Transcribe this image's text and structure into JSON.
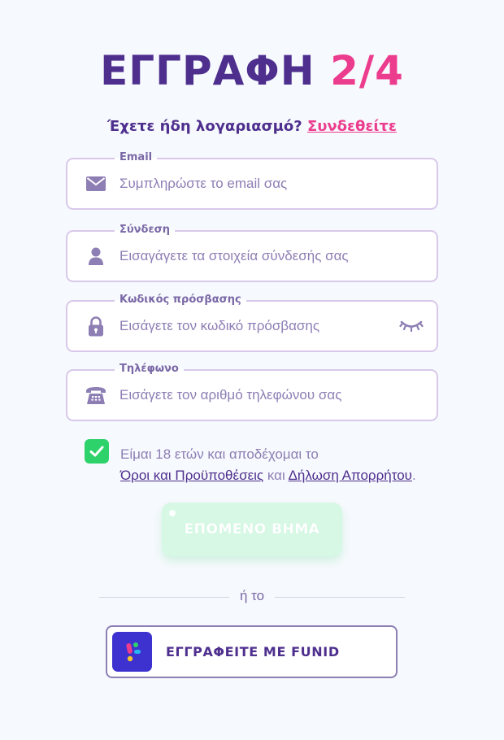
{
  "header": {
    "title": "ΕΓΓΡΑΦΗ",
    "step": "2/4",
    "login_prompt": "Έχετε ήδη λογαριασμό?",
    "login_link": "Συνδεθείτε"
  },
  "form": {
    "fields": [
      {
        "label": "Email",
        "placeholder": "Συμπληρώστε το email σας",
        "value": "",
        "icon": "envelope-icon"
      },
      {
        "label": "Σύνδεση",
        "placeholder": "Εισαγάγετε τα στοιχεία σύνδεσής σας",
        "value": "",
        "icon": "user-icon"
      },
      {
        "label": "Κωδικός πρόσβασης",
        "placeholder": "Εισάγετε τον κωδικό πρόσβασης",
        "value": "",
        "icon": "lock-icon"
      },
      {
        "label": "Τηλέφωνο",
        "placeholder": "Εισάγετε τον αριθμό τηλεφώνου σας",
        "value": "",
        "icon": "telephone-icon"
      }
    ],
    "terms": {
      "checked": true,
      "text_1": "Είμαι 18 ετών και αποδέχομαι το",
      "terms_link": "Όροι και Προϋποθέσεις",
      "and": "και",
      "privacy_link": "Δήλωση Απορρήτου",
      "end": "."
    },
    "next_button": "ΕΠΟΜΕΝΟ ΒΗΜΑ"
  },
  "alt": {
    "or_label": "ή το",
    "funid_button": "ΕΓΓΡΑΦΕΙΤΕ ΜΕ FUNID"
  },
  "colors": {
    "primary": "#4e2f8e",
    "accent": "#ec3c8d",
    "border": "#d8c9ea",
    "icon": "#8d7eb4",
    "success": "#2dd26b",
    "funid_brand": "#3d32cf"
  }
}
